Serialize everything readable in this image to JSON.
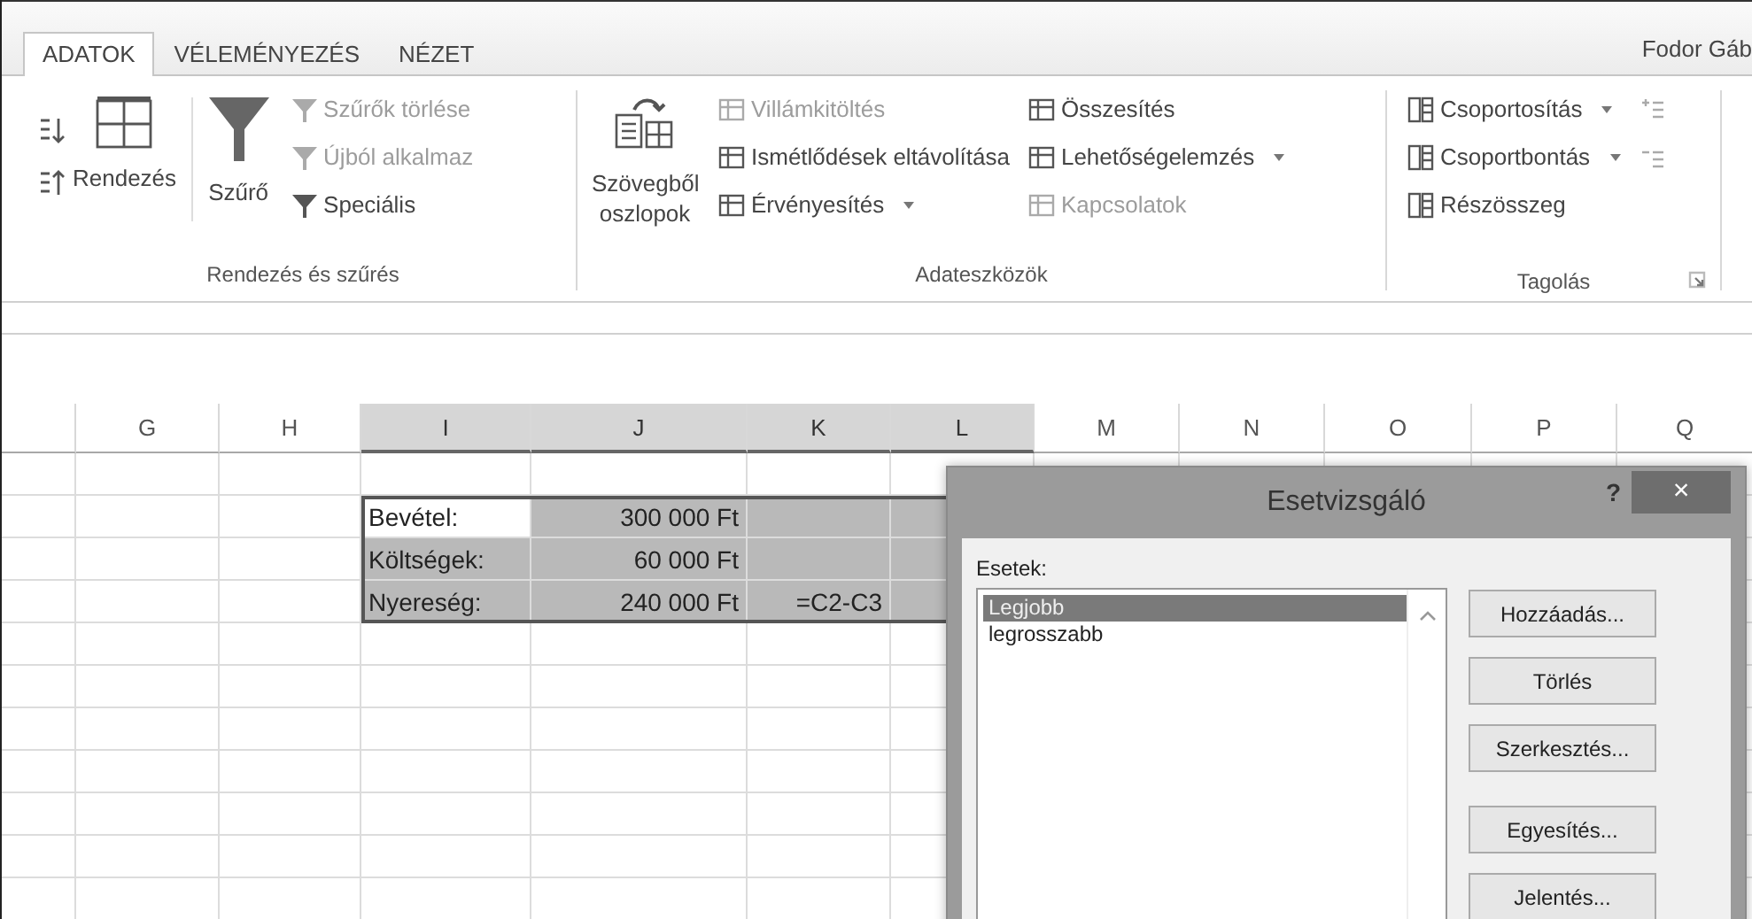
{
  "tabs": [
    {
      "label": "ADATOK",
      "selected": true
    },
    {
      "label": "VÉLEMÉNYEZÉS",
      "selected": false
    },
    {
      "label": "NÉZET",
      "selected": false
    }
  ],
  "user": "Fodor Gáb",
  "sort_filter": {
    "label": "Rendezés és szűrés",
    "sort_button": "Rendezés",
    "filter_button": "Szűrő",
    "items": [
      {
        "label": "Szűrők törlése",
        "disabled": true
      },
      {
        "label": "Újból alkalmaz",
        "disabled": true
      },
      {
        "label": "Speciális",
        "disabled": false
      }
    ]
  },
  "text_to_columns": {
    "label": "Szövegből oszlopok"
  },
  "data_tools": {
    "label": "Adateszközök",
    "columns": [
      [
        {
          "label": "Villámkitöltés",
          "disabled": true,
          "dropdown": false
        },
        {
          "label": "Ismétlődések eltávolítása",
          "disabled": false,
          "dropdown": false
        },
        {
          "label": "Érvényesítés",
          "disabled": false,
          "dropdown": true
        }
      ],
      [
        {
          "label": "Összesítés",
          "disabled": false,
          "dropdown": false
        },
        {
          "label": "Lehetőségelemzés",
          "disabled": false,
          "dropdown": true
        },
        {
          "label": "Kapcsolatok",
          "disabled": true,
          "dropdown": false
        }
      ]
    ]
  },
  "outline": {
    "label": "Tagolás",
    "items": [
      {
        "label": "Csoportosítás",
        "dropdown": true
      },
      {
        "label": "Csoportbontás",
        "dropdown": true
      },
      {
        "label": "Részösszeg",
        "dropdown": false
      }
    ]
  },
  "columns": [
    {
      "label": "G",
      "selected": false
    },
    {
      "label": "H",
      "selected": false
    },
    {
      "label": "I",
      "selected": true
    },
    {
      "label": "J",
      "selected": true
    },
    {
      "label": "K",
      "selected": true
    },
    {
      "label": "L",
      "selected": true
    },
    {
      "label": "M",
      "selected": false
    },
    {
      "label": "N",
      "selected": false
    },
    {
      "label": "O",
      "selected": false
    },
    {
      "label": "P",
      "selected": false
    },
    {
      "label": "Q",
      "selected": false
    }
  ],
  "data_rows": [
    {
      "cells": [
        {
          "text": "Bevétel:",
          "active": true
        },
        {
          "text": "300 000 Ft",
          "active": false
        },
        {
          "active": false
        },
        {
          "active": false
        }
      ]
    },
    {
      "cells": [
        {
          "text": "Költségek:",
          "active": false
        },
        {
          "text": "60 000 Ft",
          "active": false
        },
        {
          "active": false
        },
        {
          "active": false
        }
      ]
    },
    {
      "cells": [
        {
          "text": "Nyereség:",
          "active": false
        },
        {
          "text": "240 000 Ft",
          "active": false
        },
        {
          "text": "=C2-C3",
          "active": false
        },
        {
          "active": false
        }
      ]
    }
  ],
  "dialog": {
    "title": "Esetvizsgáló",
    "help": "?",
    "close": "×",
    "list_label": "Esetek:",
    "items": [
      {
        "label": "Legjobb",
        "selected": true
      },
      {
        "label": "legrosszabb",
        "selected": false
      }
    ],
    "buttons": [
      {
        "label": "Hozzáadás...",
        "separated": false
      },
      {
        "label": "Törlés",
        "separated": false
      },
      {
        "label": "Szerkesztés...",
        "separated": false
      },
      {
        "label": "Egyesítés...",
        "separated": true
      },
      {
        "label": "Jelentés...",
        "separated": false
      }
    ]
  }
}
